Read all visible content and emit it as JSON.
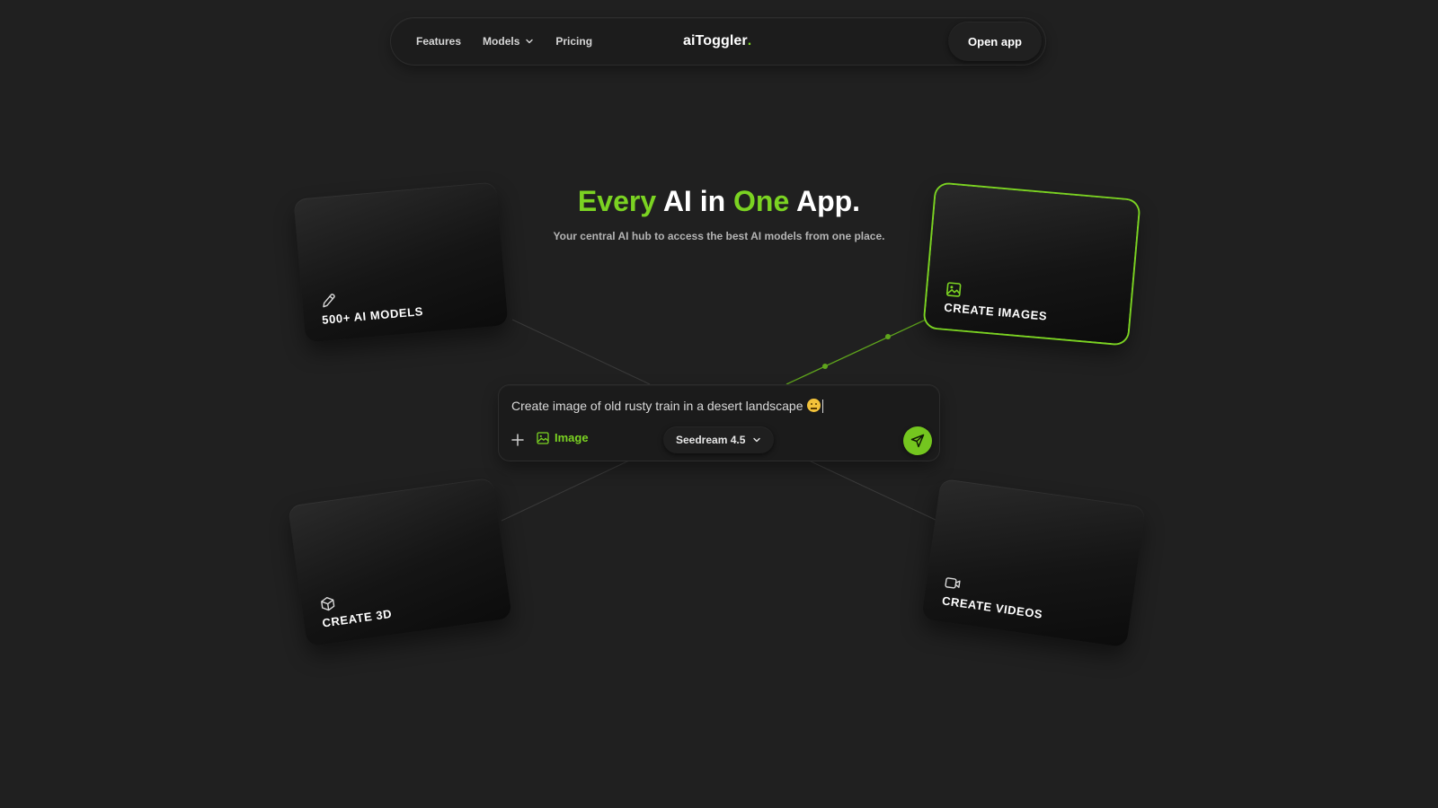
{
  "nav": {
    "links": [
      {
        "label": "Features"
      },
      {
        "label": "Models"
      },
      {
        "label": "Pricing"
      }
    ],
    "logo_text": "aiToggler",
    "logo_dot": ".",
    "cta_label": "Open app"
  },
  "hero": {
    "title_part1": "Every",
    "title_part2": " AI in ",
    "title_part3": "One",
    "title_part4": " App.",
    "subtitle": "Your central AI hub to access the best AI models from one place."
  },
  "cards": {
    "models": {
      "label": "500+ AI MODELS",
      "icon": "pencil-icon"
    },
    "images": {
      "label": "CREATE IMAGES",
      "icon": "image-icon"
    },
    "three_d": {
      "label": "CREATE 3D",
      "icon": "cube-icon"
    },
    "videos": {
      "label": "CREATE VIDEOS",
      "icon": "video-icon"
    }
  },
  "prompt": {
    "text": "Create image of old rusty train in a desert landscape",
    "mode_label": "Image",
    "model_label": "Seedream 4.5"
  },
  "colors": {
    "accent": "#7bd322",
    "background": "#202020",
    "send_button": "#74c61f"
  }
}
